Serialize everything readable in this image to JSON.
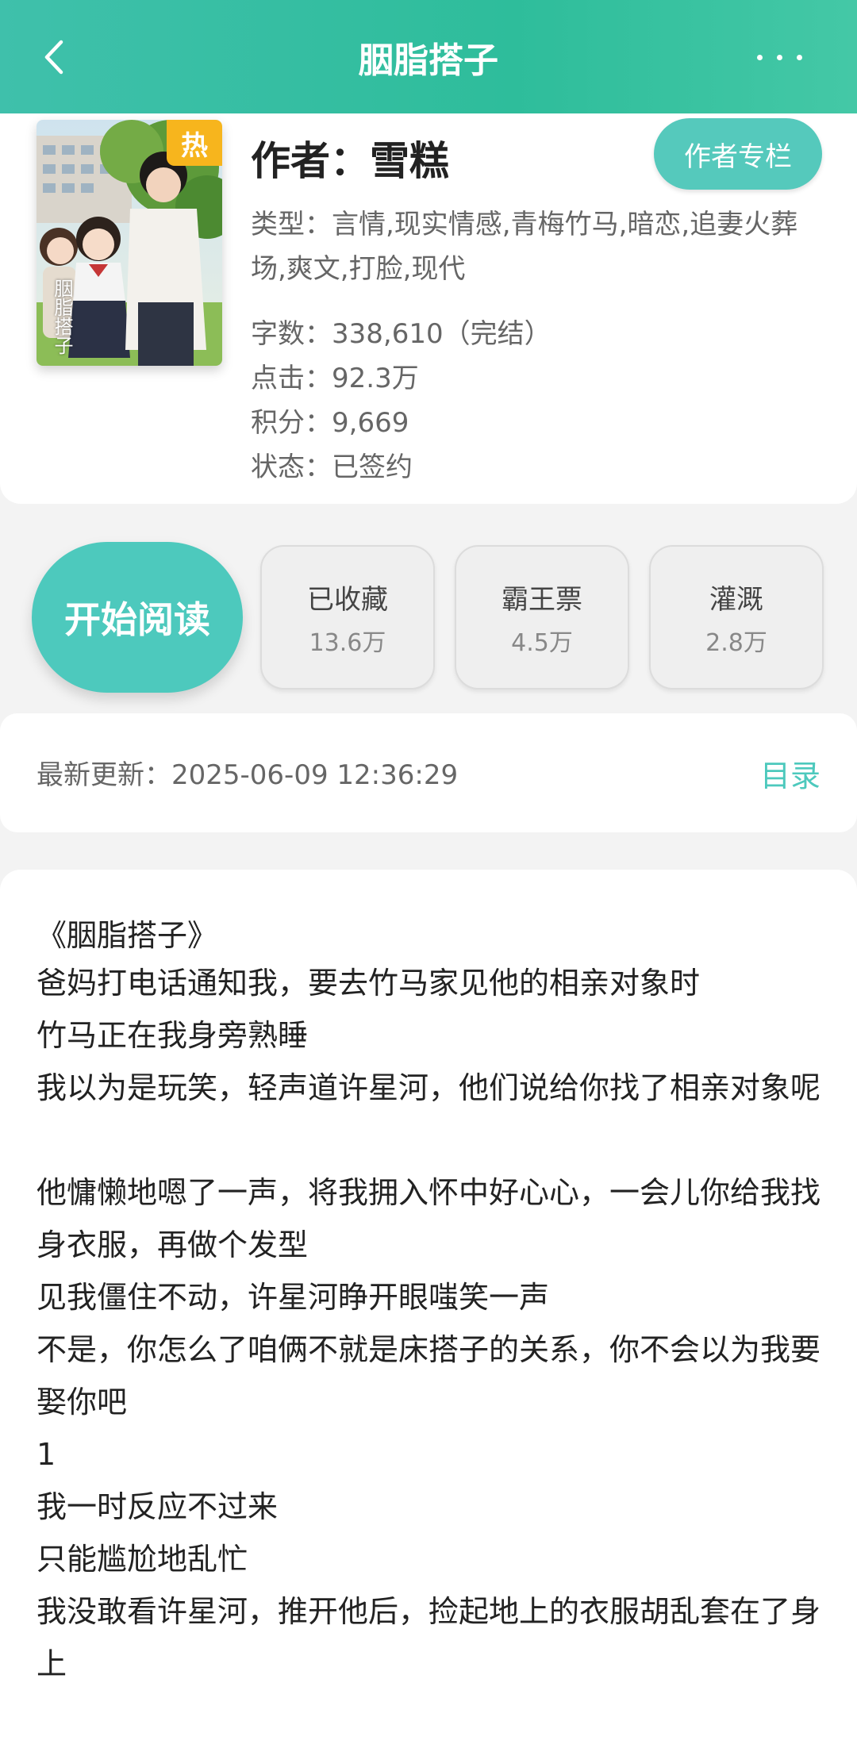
{
  "header": {
    "title": "胭脂搭子"
  },
  "book": {
    "cover_badge": "热",
    "cover_title": "胭脂搭子",
    "author_label": "作者：雪糕",
    "author_button": "作者专栏",
    "genre": "类型：言情,现实情感,青梅竹马,暗恋,追妻火葬场,爽文,打脸,现代",
    "words": "字数：338,610（完结）",
    "clicks": "点击：92.3万",
    "score": "积分：9,669",
    "status": "状态：已签约"
  },
  "actions": {
    "read_label": "开始阅读",
    "favorite": {
      "label": "已收藏",
      "value": "13.6万"
    },
    "king_ticket": {
      "label": "霸王票",
      "value": "4.5万"
    },
    "nutrient": {
      "label": "灌溉",
      "value": "2.8万"
    }
  },
  "update": {
    "text": "最新更新：2025-06-09 12:36:29",
    "toc_label": "目录"
  },
  "content": {
    "title": "《胭脂搭子》",
    "paragraphs": [
      "爸妈打电话通知我，要去竹马家见他的相亲对象时",
      "竹马正在我身旁熟睡",
      "我以为是玩笑，轻声道许星河，他们说给你找了相亲对象呢",
      "他慵懒地嗯了一声，将我拥入怀中好心心，一会儿你给我找身衣服，再做个发型",
      "见我僵住不动，许星河睁开眼嗤笑一声",
      "不是，你怎么了咱俩不就是床搭子的关系，你不会以为我要娶你吧",
      "1",
      "我一时反应不过来",
      "只能尴尬地乱忙",
      "我没敢看许星河，推开他后，捡起地上的衣服胡乱套在了身上"
    ]
  },
  "colors": {
    "header_start": "#3fc0ab",
    "header_end": "#44c8a6",
    "accent": "#4dc9bd",
    "hot_badge": "#f7b51d"
  }
}
